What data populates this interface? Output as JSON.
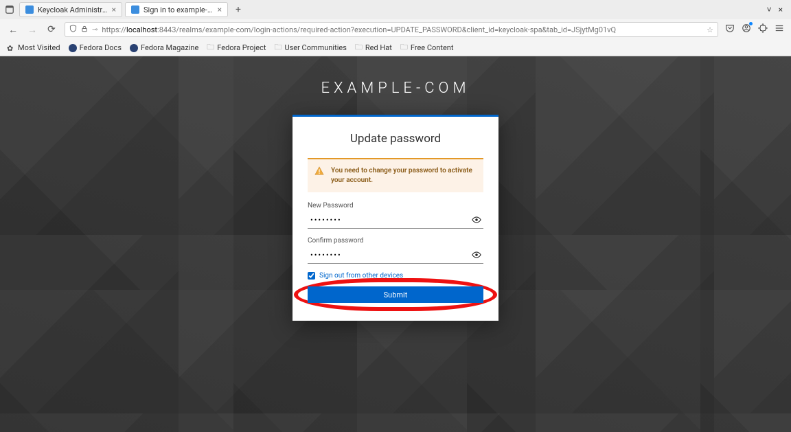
{
  "browser": {
    "tabs": [
      {
        "title": "Keycloak Administration C",
        "active": false
      },
      {
        "title": "Sign in to example-com",
        "active": true
      }
    ],
    "url_prefix": "https://",
    "url_host": "localhost",
    "url_rest": ":8443/realms/example-com/login-actions/required-action?execution=UPDATE_PASSWORD&client_id=keycloak-spa&tab_id=JSjytMg01vQ",
    "bookmarks": [
      {
        "label": "Most Visited",
        "icon": "star"
      },
      {
        "label": "Fedora Docs",
        "icon": "fedora"
      },
      {
        "label": "Fedora Magazine",
        "icon": "fedora"
      },
      {
        "label": "Fedora Project",
        "icon": "folder"
      },
      {
        "label": "User Communities",
        "icon": "folder"
      },
      {
        "label": "Red Hat",
        "icon": "folder"
      },
      {
        "label": "Free Content",
        "icon": "folder"
      }
    ]
  },
  "page": {
    "realm_title": "EXAMPLE-COM",
    "card_title": "Update password",
    "alert_text": "You need to change your password to activate your account.",
    "new_password_label": "New Password",
    "new_password_value": "••••••••",
    "confirm_password_label": "Confirm password",
    "confirm_password_value": "••••••••",
    "signout_label": "Sign out from other devices",
    "signout_checked": true,
    "submit_label": "Submit"
  }
}
